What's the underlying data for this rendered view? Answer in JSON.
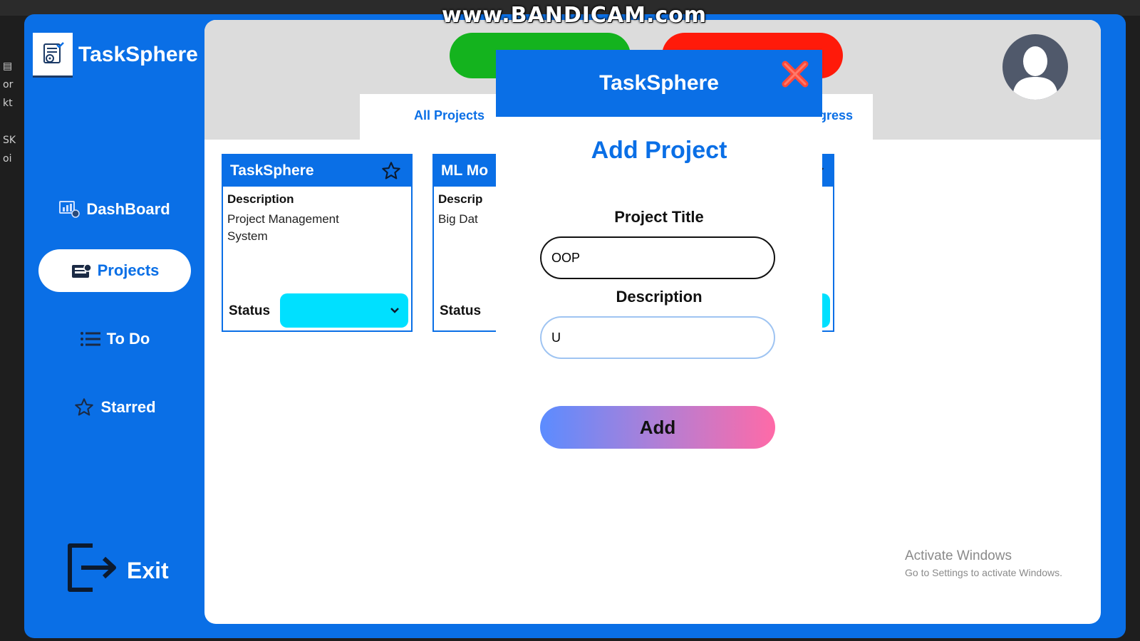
{
  "recording_watermark": "www.BANDICAM.com",
  "app": {
    "brand": "TaskSphere"
  },
  "sidebar": {
    "items": [
      {
        "label": "DashBoard",
        "icon": "dashboard-icon"
      },
      {
        "label": "Projects",
        "icon": "projects-icon",
        "active": true
      },
      {
        "label": "To Do",
        "icon": "list-icon"
      },
      {
        "label": "Starred",
        "icon": "star-icon"
      }
    ],
    "exit_label": "Exit"
  },
  "tabs": [
    {
      "label": "All Projects"
    },
    {
      "label": "rogress"
    }
  ],
  "cards": [
    {
      "title": "TaskSphere",
      "description_label": "Description",
      "description": "Project Management System",
      "status_label": "Status"
    },
    {
      "title": "ML Mo",
      "description_label": "Descrip",
      "description": "Big Dat",
      "status_label": "Status"
    }
  ],
  "modal": {
    "header": "TaskSphere",
    "title": "Add Project",
    "project_title_label": "Project Title",
    "project_title_value": "OOP",
    "description_label": "Description",
    "description_value": "U",
    "add_label": "Add"
  },
  "windows_activation": {
    "line1": "Activate Windows",
    "line2": "Go to Settings to activate Windows."
  },
  "colors": {
    "primary": "#0a6fe6",
    "status_select": "#00e0ff",
    "green_button": "#14b31e",
    "red_button": "#ff1a0a",
    "close_x": "#ff4a3a"
  }
}
